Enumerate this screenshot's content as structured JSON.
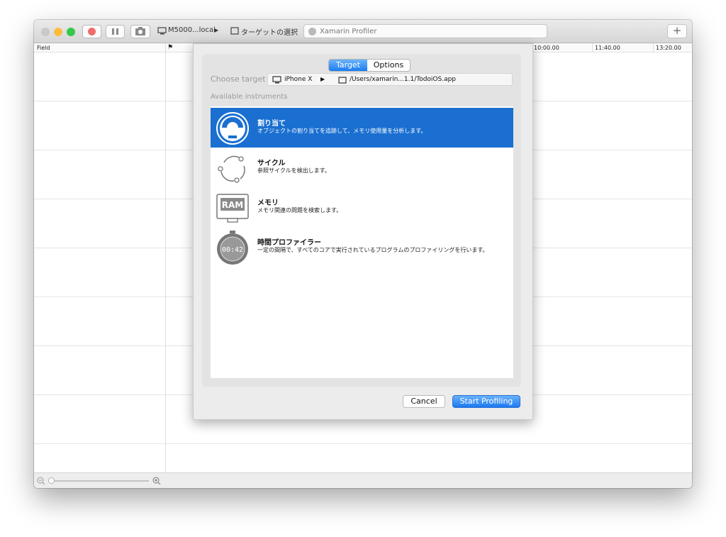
{
  "toolbar": {
    "device_label": "M5000...local",
    "target_label": "ターゲットの選択",
    "profiler_label": "Xamarin Profiler",
    "add_label": "+",
    "play_glyph": "▶"
  },
  "header": {
    "field_label": "Field",
    "times": [
      "10:00.00",
      "11:40.00",
      "13:20.00"
    ]
  },
  "dialog": {
    "tabs": {
      "target": "Target",
      "options": "Options"
    },
    "choose_target_label": "Choose target",
    "device_name": "iPhone X",
    "app_path": "/Users/xamarin...1.1/TodoiOS.app",
    "available_label": "Available instruments",
    "instruments": [
      {
        "title": "割り当て",
        "description": "オブジェクトの割り当てを追跡して、メモリ使用量を分析します。",
        "icon": "allocations-icon",
        "selected": true
      },
      {
        "title": "サイクル",
        "description": "参照サイクルを検出します。",
        "icon": "cycles-icon",
        "selected": false
      },
      {
        "title": "メモリ",
        "description": "メモリ関連の問題を検索します。",
        "icon": "ram-icon",
        "icon_text": "RAM",
        "selected": false
      },
      {
        "title": "時間プロファイラー",
        "description": "一定の間隔で、すべてのコアで実行されているプログラムのプロファイリングを行います。",
        "icon": "stopwatch-icon",
        "icon_text": "00:42",
        "selected": false
      }
    ],
    "cancel_label": "Cancel",
    "start_label": "Start Profiling"
  },
  "colors": {
    "accent": "#1a6fd1",
    "close": "#fc605c",
    "minimize": "#fdbc40",
    "zoom": "#34c84a",
    "record": "#f06c6c"
  }
}
